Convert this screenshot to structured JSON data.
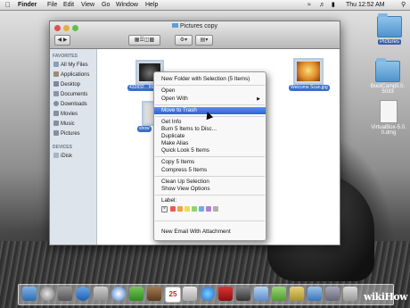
{
  "menubar": {
    "apple": "",
    "items": [
      "Finder",
      "File",
      "Edit",
      "View",
      "Go",
      "Window",
      "Help"
    ],
    "clock": "Thu 12:52 AM"
  },
  "desktop_icons": [
    {
      "label": "Pictures",
      "selected": true,
      "kind": "folder"
    },
    {
      "label": "BootCamp5.0.5033",
      "selected": false,
      "kind": "folder"
    },
    {
      "label": "VirtualBox-5.0.0.dmg",
      "selected": false,
      "kind": "doc"
    }
  ],
  "finder": {
    "title": "Pictures copy",
    "sidebar": {
      "favorites_header": "FAVORITES",
      "favorites": [
        "All My Files",
        "Applications",
        "Desktop",
        "Documents",
        "Downloads",
        "Movies",
        "Music",
        "Pictures"
      ],
      "devices_header": "DEVICES",
      "devices": [
        "iDisk"
      ]
    },
    "files": [
      {
        "label": "432832…965477"
      },
      {
        "label": "show"
      },
      {
        "label": "Welcome Scan.jpg"
      }
    ]
  },
  "context_menu": {
    "items": {
      "new_folder": "New Folder with Selection (5 Items)",
      "open": "Open",
      "open_with": "Open With",
      "move_to_trash": "Move to Trash",
      "get_info": "Get Info",
      "burn": "Burn 5 Items to Disc...",
      "duplicate": "Duplicate",
      "make_alias": "Make Alias",
      "quick_look": "Quick Look 5 Items",
      "copy": "Copy 5 Items",
      "compress": "Compress 5 Items",
      "cleanup": "Clean Up Selection",
      "view_options": "Show View Options",
      "label": "Label:",
      "new_email": "New Email With Attachment"
    },
    "highlighted": "Move to Trash",
    "label_colors": [
      "#e85a4f",
      "#f3a33c",
      "#f0dc4b",
      "#8fd46a",
      "#6fa8ec",
      "#b27fd6",
      "#b0b0b0"
    ]
  },
  "watermark": "wikiHow"
}
